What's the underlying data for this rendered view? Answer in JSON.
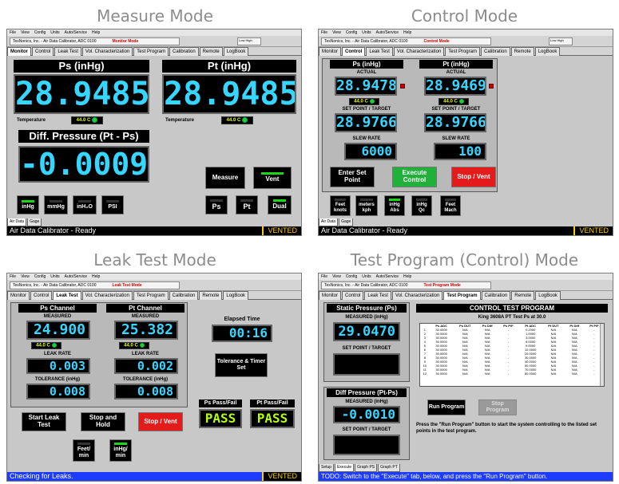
{
  "quads": {
    "measure": "Measure Mode",
    "control": "Control Mode",
    "leak": "Leak Test Mode",
    "program": "Test Program (Control) Mode"
  },
  "menu": [
    "File",
    "View",
    "Config",
    "Units",
    "Auto/Service",
    "Help"
  ],
  "company": "TesNonics, Inc. - Air Data Calibrator, ADC 0100",
  "lowhigh": "Low High",
  "tabs": [
    "Monitor",
    "Control",
    "Leak Test",
    "Vol. Characterization",
    "Test Program",
    "Calibration",
    "Remote",
    "LogBook"
  ],
  "vented": "VENTED",
  "measure": {
    "mode_label": "Monitor Mode",
    "ps_header": "Ps (inHg)",
    "pt_header": "Pt (inHg)",
    "ps_value": "28.9485",
    "pt_value": "28.9485",
    "temp_label": "Temperature",
    "temp_value": "44.0 C",
    "diff_header": "Diff. Pressure (Pt - Ps)",
    "diff_value": "-0.0009",
    "btn_measure": "Measure",
    "btn_vent": "Vent",
    "unit_buttons": [
      "inHg",
      "mmHg",
      "inH₂O",
      "PSI"
    ],
    "btn_ps": "Ps",
    "btn_pt": "Pt",
    "btn_dual": "Dual",
    "bottom_tabs": [
      "Air Data",
      "Gage"
    ],
    "status": "Air Data Calibrator - Ready"
  },
  "control": {
    "mode_label": "Control Mode",
    "ps_header": "Ps (inHg)",
    "pt_header": "Pt (inHg)",
    "actual_label": "ACTUAL",
    "ps_actual": "28.9478",
    "pt_actual": "28.9469",
    "temp_value": "44.0 C",
    "setpoint_label": "SET POINT / TARGET",
    "ps_set": "28.9766",
    "pt_set": "28.9766",
    "slew_label": "SLEW RATE",
    "ps_slew": "6000",
    "pt_slew": "100",
    "btn_enter": "Enter Set Point",
    "btn_execute": "Execute Control",
    "btn_stop": "Stop / Vent",
    "unit_buttons": [
      {
        "top": "Feet",
        "bottom": "knots"
      },
      {
        "top": "meters",
        "bottom": "kph"
      },
      {
        "top": "inHg",
        "bottom": "Abs"
      },
      {
        "top": "inHg",
        "bottom": "Qc"
      },
      {
        "top": "Feet",
        "bottom": "Mach"
      }
    ],
    "bottom_tabs": [
      "Air Data",
      "Gage"
    ],
    "status": "Air Data Calibrator - Ready"
  },
  "leak": {
    "mode_label": "Leak Test Mode",
    "ps_channel": "Ps Channel",
    "pt_channel": "Pt Channel",
    "measured_label": "MEASURED",
    "ps_measured": "24.900",
    "pt_measured": "25.382",
    "temp_value": "44.0 C",
    "leak_rate_label": "LEAK RATE",
    "ps_leak": "0.003",
    "pt_leak": "0.002",
    "tolerance_label": "TOLERANCE (inHg)",
    "ps_tol": "0.008",
    "pt_tol": "0.008",
    "elapsed_label": "Elapsed Time",
    "elapsed_value": "00:16",
    "btn_tolerance": "Tolerance & Timer Set",
    "ps_pass_label": "Ps Pass/Fail",
    "pt_pass_label": "Pt Pass/Fail",
    "ps_pass": "PASS",
    "pt_pass": "PASS",
    "btn_start": "Start Leak Test",
    "btn_stophold": "Stop and Hold",
    "btn_stopvent": "Stop / Vent",
    "btn_feet": "Feet/ min",
    "btn_inhg": "inHg/ min",
    "status": "Checking for Leaks."
  },
  "program": {
    "mode_label": "Test Program Mode",
    "static_header": "Static Pressure (Ps)",
    "measured_label": "MEASURED (inHg)",
    "static_value": "29.0470",
    "setpoint_label": "SET POINT / TARGET",
    "diff_header": "Diff Pressure (Pt-Ps)",
    "diff_value": "-0.0010",
    "table_title": "CONTROL TEST PROGRAM",
    "table_subtitle": "King 3608A PT Test Ps at 30.0",
    "columns": [
      "",
      "Ps ADC",
      "Ps DUT",
      "Ps Diff",
      "Ps P/F",
      "Pt ADC",
      "Pt DUT",
      "Pt Diff",
      "Pt P/F"
    ],
    "rows": [
      [
        "1",
        "30.0000",
        "N/A",
        "N/A",
        "-",
        "0.2000",
        "N/A",
        "N/A",
        "-"
      ],
      [
        "2",
        "30.0000",
        "N/A",
        "N/A",
        "-",
        "1.0000",
        "N/A",
        "N/A",
        "-"
      ],
      [
        "3",
        "30.0000",
        "N/A",
        "N/A",
        "-",
        "3.0000",
        "N/A",
        "N/A",
        "-"
      ],
      [
        "4",
        "30.0000",
        "N/A",
        "N/A",
        "-",
        "6.0000",
        "N/A",
        "N/A",
        "-"
      ],
      [
        "5",
        "30.0000",
        "N/A",
        "N/A",
        "-",
        "9.0000",
        "N/A",
        "N/A",
        "-"
      ],
      [
        "6",
        "30.0000",
        "N/A",
        "N/A",
        "-",
        "12.0000",
        "N/A",
        "N/A",
        "-"
      ],
      [
        "7",
        "30.0000",
        "N/A",
        "N/A",
        "-",
        "20.0000",
        "N/A",
        "N/A",
        "-"
      ],
      [
        "8",
        "30.0000",
        "N/A",
        "N/A",
        "-",
        "30.0000",
        "N/A",
        "N/A",
        "-"
      ],
      [
        "9",
        "30.0000",
        "N/A",
        "N/A",
        "-",
        "40.0000",
        "N/A",
        "N/A",
        "-"
      ],
      [
        "10",
        "30.0000",
        "N/A",
        "N/A",
        "-",
        "50.0000",
        "N/A",
        "N/A",
        "-"
      ],
      [
        "11",
        "30.0000",
        "N/A",
        "N/A",
        "-",
        "70.0000",
        "N/A",
        "N/A",
        "-"
      ],
      [
        "12",
        "30.0000",
        "N/A",
        "N/A",
        "-",
        "80.0000",
        "N/A",
        "N/A",
        "-"
      ]
    ],
    "btn_run": "Run Program",
    "btn_stop": "Stop Program",
    "instructions": "Press the \"Run Program\" button to start the system controlling to the listed set points in the test program.",
    "bottom_tabs": [
      "Setup",
      "Execute",
      "Graph PS",
      "Graph PT"
    ],
    "status": "TODO: Switch to the \"Execute\" tab, below, and press the \"Run Program\" button."
  }
}
